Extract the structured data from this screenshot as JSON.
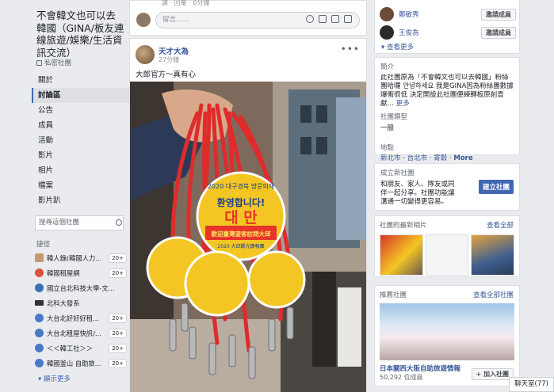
{
  "group": {
    "name": "不會韓文也可以去韓國（GINA/板友連線旅遊/娛樂/生活資訊交流）",
    "privacy": "私密社團"
  },
  "nav": [
    {
      "label": "關於",
      "active": false
    },
    {
      "label": "討論區",
      "active": true
    },
    {
      "label": "公告",
      "active": false
    },
    {
      "label": "成員",
      "active": false
    },
    {
      "label": "活動",
      "active": false
    },
    {
      "label": "影片",
      "active": false
    },
    {
      "label": "相片",
      "active": false
    },
    {
      "label": "檔案",
      "active": false
    },
    {
      "label": "影片趴",
      "active": false
    }
  ],
  "search": {
    "placeholder": "搜尋這個社團"
  },
  "shortcuts": {
    "title": "捷徑",
    "items": [
      {
        "label": "韓人錄(韓國人力...",
        "badge": "20+",
        "color": "#c49a6c"
      },
      {
        "label": "韓國租屋網",
        "badge": "20+",
        "color": "#e0513a"
      },
      {
        "label": "國立台北科技大學-文...",
        "badge": "",
        "color": "#3b6fb6"
      },
      {
        "label": "北科大發系",
        "badge": "",
        "color": "#333333"
      },
      {
        "label": "大台北好好好租...",
        "badge": "20+",
        "color": "#4a79c9"
      },
      {
        "label": "大台北租屋快訊/...",
        "badge": "20+",
        "color": "#4a79c9"
      },
      {
        "label": "＜＜韓工社＞＞",
        "badge": "20+",
        "color": "#4a79c9"
      },
      {
        "label": "韓國釜山 自助旅...",
        "badge": "20+",
        "color": "#4a79c9"
      }
    ],
    "see_more": "顯示更多"
  },
  "feed": {
    "prev_meta": "讚 · 回覆 · 6分鐘",
    "comment_placeholder": "留言……",
    "post": {
      "author": "天才大為",
      "time": "27分鐘",
      "text": "大郎官方～真有心",
      "photo": {
        "medal_line1": "환영합니다!",
        "medal_line2": "대 만",
        "medal_line3": "歡迎臺灣遊客訪問大邱",
        "medal_line4": "2020 大邱觀光廣報團",
        "medal_top": "2020 대구경북 방문의해"
      }
    }
  },
  "right": {
    "members": [
      {
        "name": "鄭敏秀",
        "button": "邀請成員"
      },
      {
        "name": "王俊為",
        "button": "邀請成員"
      }
    ],
    "see_more": "查看更多",
    "about_title": "簡介",
    "about_text": "此社團原為「不會韓文也可以去韓國」粉絲團哈囉 안녕하세요 我是GINA因為粉絲團數據爆衝很低 決定開設此社團便練轉板原創貢獻…",
    "about_more": "更多",
    "type_title": "社團類型",
    "type_value": "一般",
    "location_title": "地點",
    "locations": [
      "新北市",
      "台北市",
      "寄穀",
      "More"
    ],
    "create_title": "成立新社團",
    "create_text": "和朋友、家人、隊友或同伴一起分享。社團功能讓溝通一切變得更容易。",
    "create_button": "建立社團",
    "photos_title": "社團的最新相片",
    "photos_link": "查看全部",
    "rec_title": "推薦社團",
    "rec_link": "查看全部社團",
    "rec_group_name": "日本關西大阪自助旅遊情報",
    "rec_group_members": "50,292 位成員",
    "rec_join": "+ 加入社團"
  },
  "chat": {
    "label": "聊天室(77)"
  }
}
